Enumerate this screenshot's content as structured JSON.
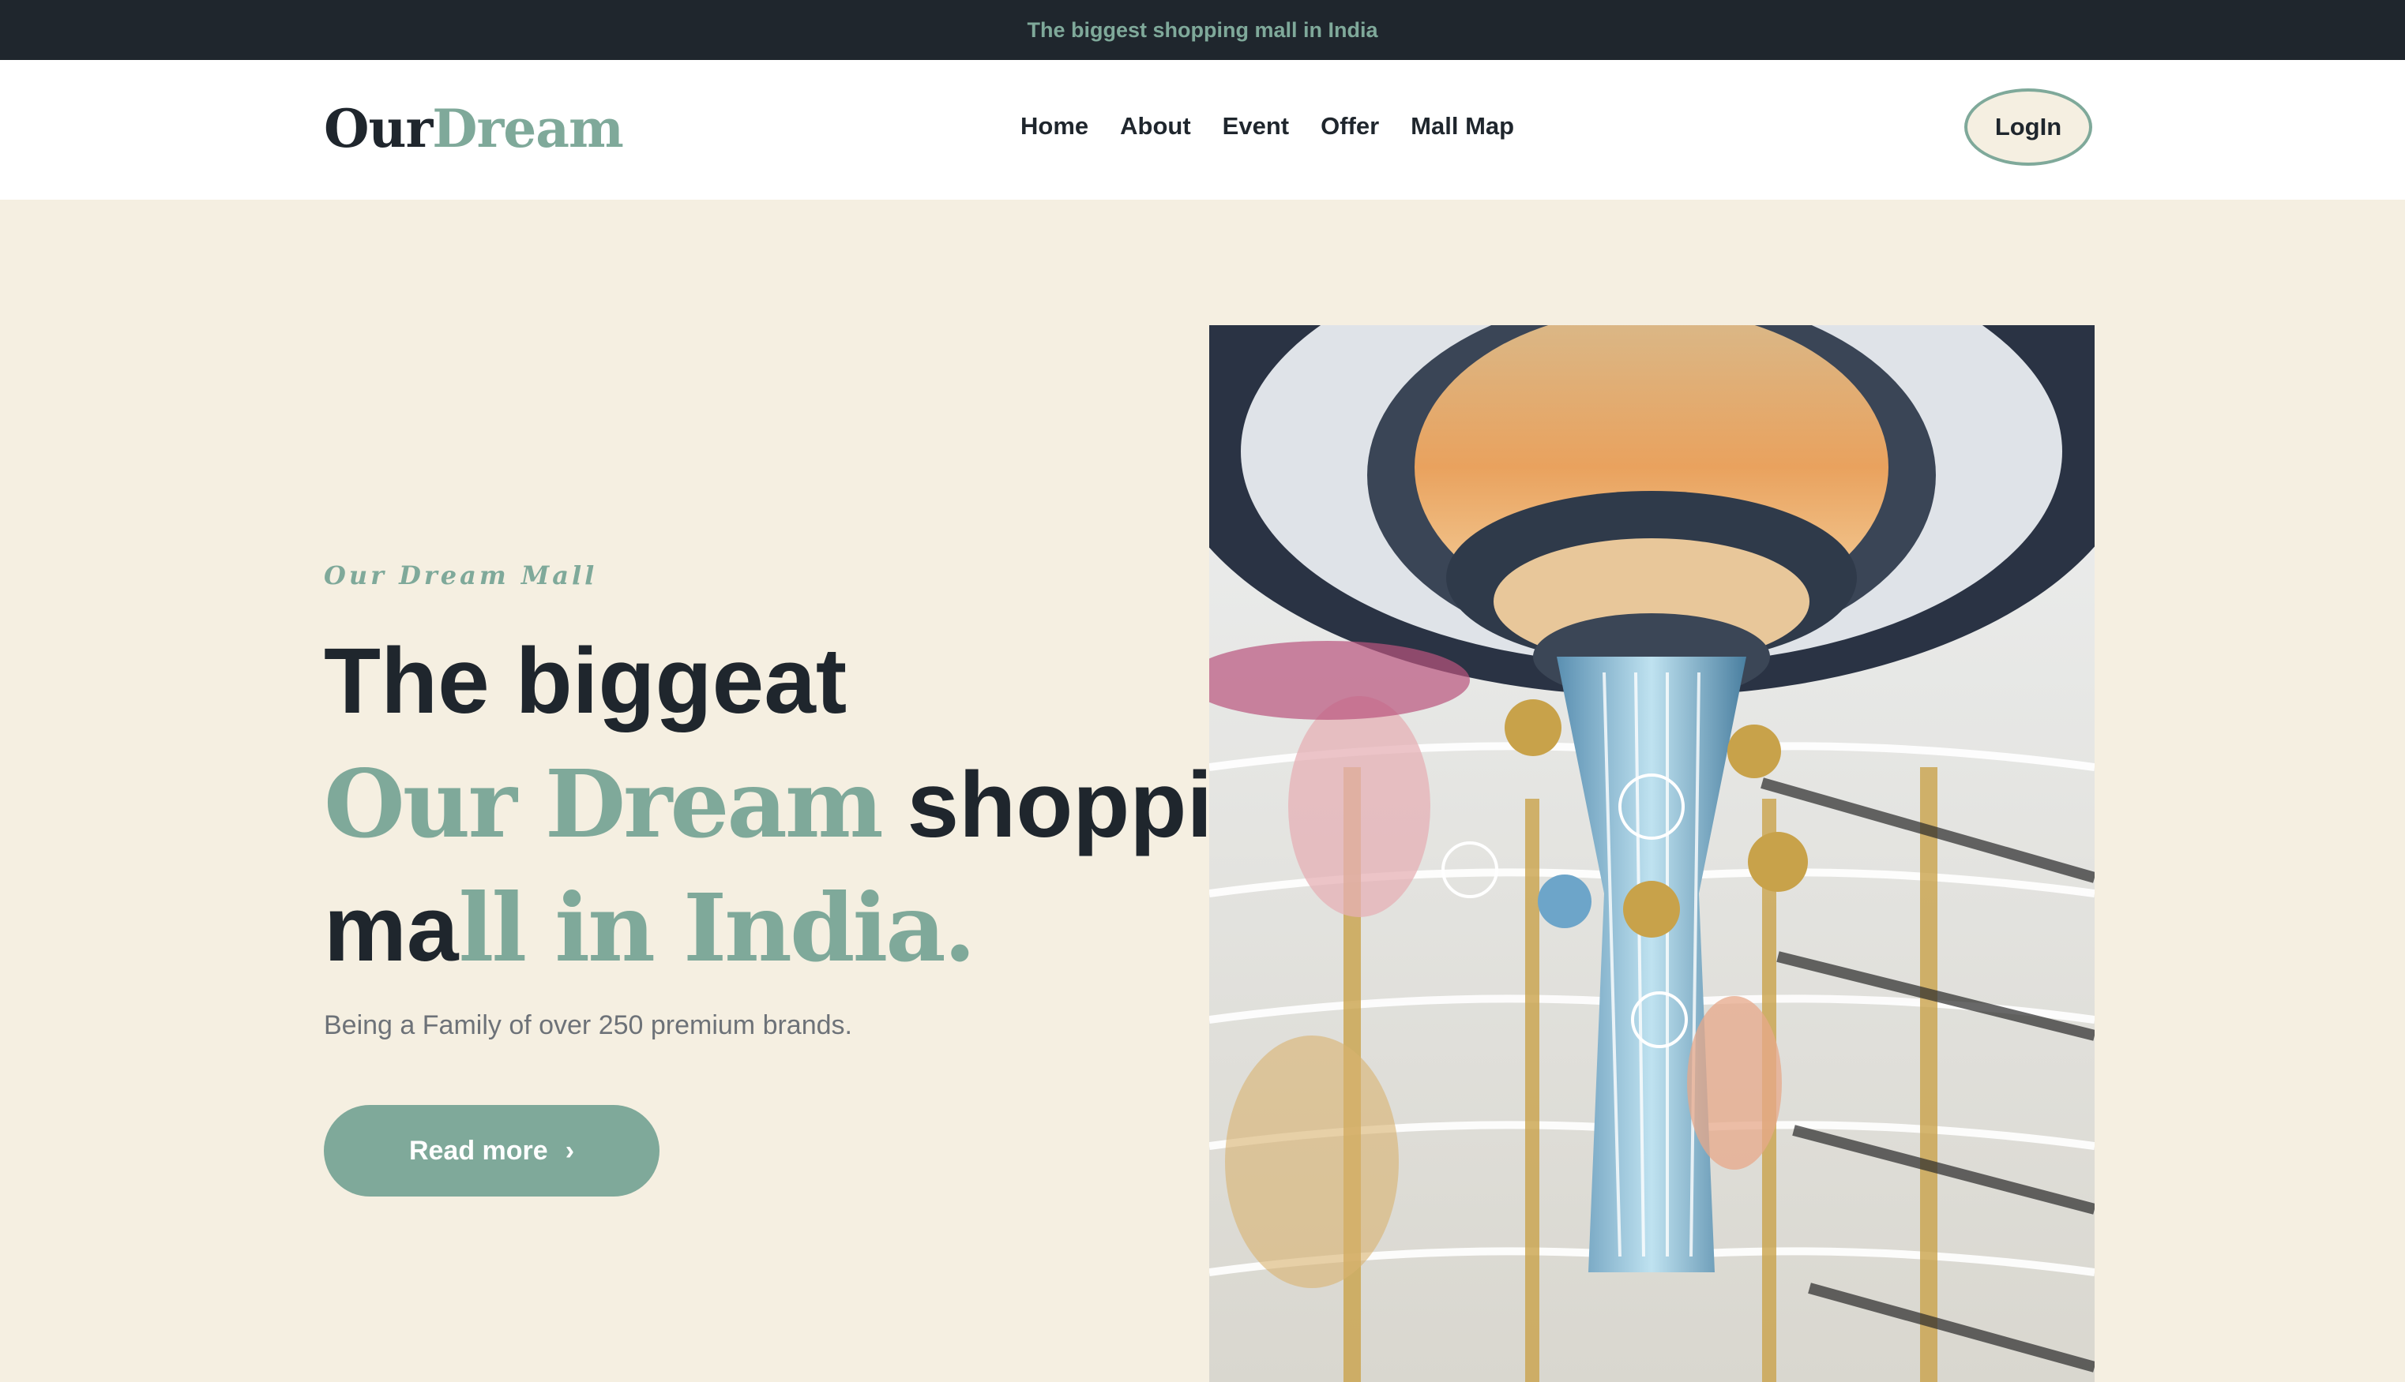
{
  "topbar": {
    "text": "The biggest shopping mall in India"
  },
  "navbar": {
    "logo_part1": "Our",
    "logo_part2": "Dream",
    "links": [
      "Home",
      "About",
      "Event",
      "Offer",
      "Mall Map"
    ],
    "login_label": "LogIn"
  },
  "hero": {
    "subtitle": "Our Dream Mall",
    "headline": {
      "line1": "The biggeat",
      "line2_serif": "Our Dream",
      "line2_rest": "shopping",
      "line3_plain": "ma",
      "line3_serif": "ll in India."
    },
    "description": "Being a Family of over 250 premium brands.",
    "cta_label": "Read more",
    "image_subject": "mall-atrium-photo"
  },
  "colors": {
    "dark": "#1f262d",
    "accent": "#7fa99a",
    "background": "#f5efe1"
  }
}
